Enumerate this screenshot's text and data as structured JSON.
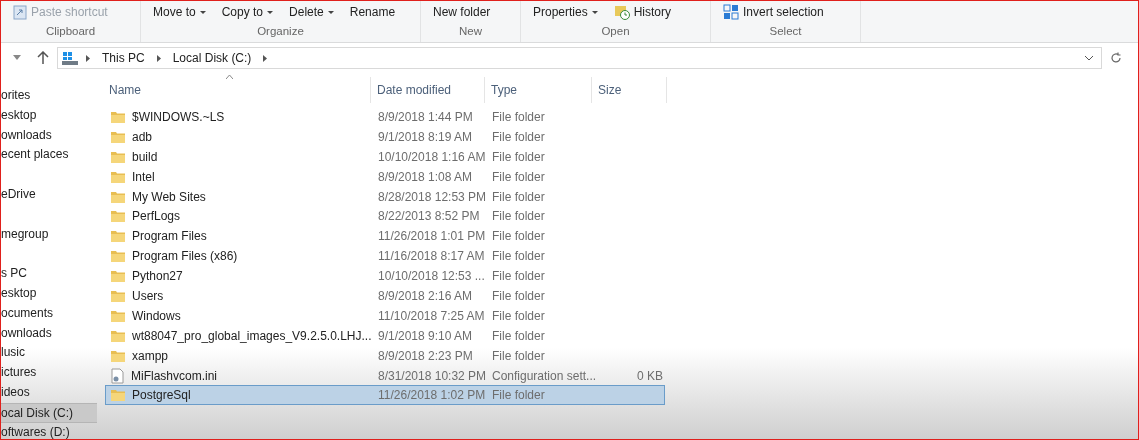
{
  "ribbon": {
    "groups": [
      {
        "label": "Clipboard",
        "commands": [
          {
            "label": "Paste shortcut",
            "kind": "shortcut",
            "dropdown": false,
            "disabled": true
          }
        ]
      },
      {
        "label": "Organize",
        "commands": [
          {
            "label": "Move to",
            "kind": "plain",
            "dropdown": true,
            "disabled": false
          },
          {
            "label": "Copy to",
            "kind": "plain",
            "dropdown": true,
            "disabled": false
          },
          {
            "label": "Delete",
            "kind": "plain",
            "dropdown": true,
            "disabled": false
          },
          {
            "label": "Rename",
            "kind": "plain",
            "dropdown": false,
            "disabled": false
          }
        ]
      },
      {
        "label": "New",
        "commands": [
          {
            "label": "New folder",
            "kind": "plain",
            "dropdown": false,
            "disabled": false
          }
        ]
      },
      {
        "label": "Open",
        "commands": [
          {
            "label": "Properties",
            "kind": "plain",
            "dropdown": true,
            "disabled": false
          },
          {
            "label": "History",
            "kind": "history",
            "dropdown": false,
            "disabled": false
          }
        ]
      },
      {
        "label": "Select",
        "commands": [
          {
            "label": "Invert selection",
            "kind": "invert",
            "dropdown": false,
            "disabled": false
          }
        ]
      }
    ]
  },
  "address_bar": {
    "path": [
      "This PC",
      "Local Disk (C:)"
    ]
  },
  "sidebar": {
    "sections": [
      {
        "items": [
          {
            "label": "orites",
            "selected": false
          },
          {
            "label": "esktop",
            "selected": false
          },
          {
            "label": "ownloads",
            "selected": false
          },
          {
            "label": "ecent places",
            "selected": false
          }
        ]
      },
      {
        "items": [
          {
            "label": "eDrive",
            "selected": false
          }
        ]
      },
      {
        "items": [
          {
            "label": "megroup",
            "selected": false
          }
        ]
      },
      {
        "items": [
          {
            "label": "s PC",
            "selected": false
          },
          {
            "label": "esktop",
            "selected": false
          },
          {
            "label": "ocuments",
            "selected": false
          },
          {
            "label": "ownloads",
            "selected": false
          },
          {
            "label": "lusic",
            "selected": false
          },
          {
            "label": "ictures",
            "selected": false
          },
          {
            "label": "ideos",
            "selected": false
          },
          {
            "label": "ocal Disk (C:)",
            "selected": true
          },
          {
            "label": "oftwares (D:)",
            "selected": false
          }
        ]
      }
    ]
  },
  "file_list": {
    "columns": [
      "Name",
      "Date modified",
      "Type",
      "Size"
    ],
    "rows": [
      {
        "kind": "folder",
        "name": "$WINDOWS.~LS",
        "date": "8/9/2018 1:44 PM",
        "type": "File folder",
        "selected": false
      },
      {
        "kind": "folder",
        "name": "adb",
        "date": "9/1/2018 8:19 AM",
        "type": "File folder",
        "selected": false
      },
      {
        "kind": "folder",
        "name": "build",
        "date": "10/10/2018 1:16 AM",
        "type": "File folder",
        "selected": false
      },
      {
        "kind": "folder",
        "name": "Intel",
        "date": "8/9/2018 1:08 AM",
        "type": "File folder",
        "selected": false
      },
      {
        "kind": "folder",
        "name": "My Web Sites",
        "date": "8/28/2018 12:53 PM",
        "type": "File folder",
        "selected": false
      },
      {
        "kind": "folder",
        "name": "PerfLogs",
        "date": "8/22/2013 8:52 PM",
        "type": "File folder",
        "selected": false
      },
      {
        "kind": "folder",
        "name": "Program Files",
        "date": "11/26/2018 1:01 PM",
        "type": "File folder",
        "selected": false
      },
      {
        "kind": "folder",
        "name": "Program Files (x86)",
        "date": "11/16/2018 8:17 AM",
        "type": "File folder",
        "selected": false
      },
      {
        "kind": "folder",
        "name": "Python27",
        "date": "10/10/2018 12:53 ...",
        "type": "File folder",
        "selected": false
      },
      {
        "kind": "folder",
        "name": "Users",
        "date": "8/9/2018 2:16 AM",
        "type": "File folder",
        "selected": false
      },
      {
        "kind": "folder",
        "name": "Windows",
        "date": "11/10/2018 7:25 AM",
        "type": "File folder",
        "selected": false
      },
      {
        "kind": "folder",
        "name": "wt88047_pro_global_images_V9.2.5.0.LHJ...",
        "date": "9/1/2018 9:10 AM",
        "type": "File folder",
        "selected": false
      },
      {
        "kind": "folder",
        "name": "xampp",
        "date": "8/9/2018 2:23 PM",
        "type": "File folder",
        "selected": false
      },
      {
        "kind": "settings-file",
        "name": "MiFlashvcom.ini",
        "date": "8/31/2018 10:32 PM",
        "type": "Configuration sett...",
        "size": "0 KB",
        "selected": false
      },
      {
        "kind": "folder",
        "name": "PostgreSql",
        "date": "11/26/2018 1:02 PM",
        "type": "File folder",
        "selected": true
      }
    ]
  }
}
